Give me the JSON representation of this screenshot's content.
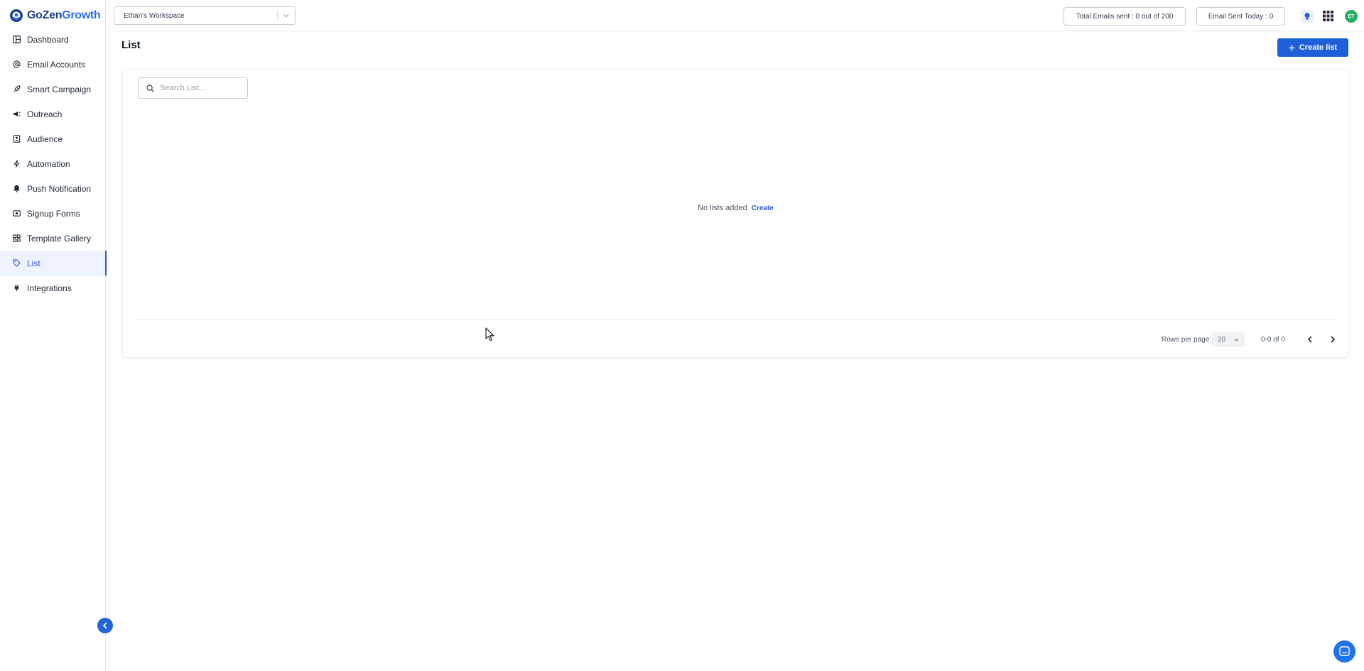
{
  "brand": {
    "name_part1": "GoZen",
    "name_part2": "Growth"
  },
  "sidebar": {
    "items": [
      {
        "label": "Dashboard",
        "icon": "dashboard-icon"
      },
      {
        "label": "Email Accounts",
        "icon": "at-sign-icon"
      },
      {
        "label": "Smart Campaign",
        "icon": "rocket-icon"
      },
      {
        "label": "Outreach",
        "icon": "megaphone-icon"
      },
      {
        "label": "Audience",
        "icon": "contacts-icon"
      },
      {
        "label": "Automation",
        "icon": "bolt-icon"
      },
      {
        "label": "Push Notification",
        "icon": "bell-icon"
      },
      {
        "label": "Signup Forms",
        "icon": "form-icon"
      },
      {
        "label": "Template Gallery",
        "icon": "grid-icon"
      },
      {
        "label": "List",
        "icon": "tag-icon",
        "active": true
      },
      {
        "label": "Integrations",
        "icon": "plug-icon"
      }
    ]
  },
  "header": {
    "workspace": "Ethan's Workspace",
    "total_emails": "Total Emails sent : 0 out of 200",
    "sent_today": "Email Sent Today : 0",
    "avatar_initials": "ET"
  },
  "main": {
    "title": "List",
    "create_button": "Create list",
    "search_placeholder": "Search List...",
    "empty_message": "No lists added",
    "empty_link": "Create",
    "pagination": {
      "rows_label": "Rows per page:",
      "rows_value": "20",
      "range": "0-0 of 0"
    }
  },
  "colors": {
    "accent": "#1e5fd8",
    "active_bg": "#eef3fd",
    "avatar": "#25b25e"
  }
}
